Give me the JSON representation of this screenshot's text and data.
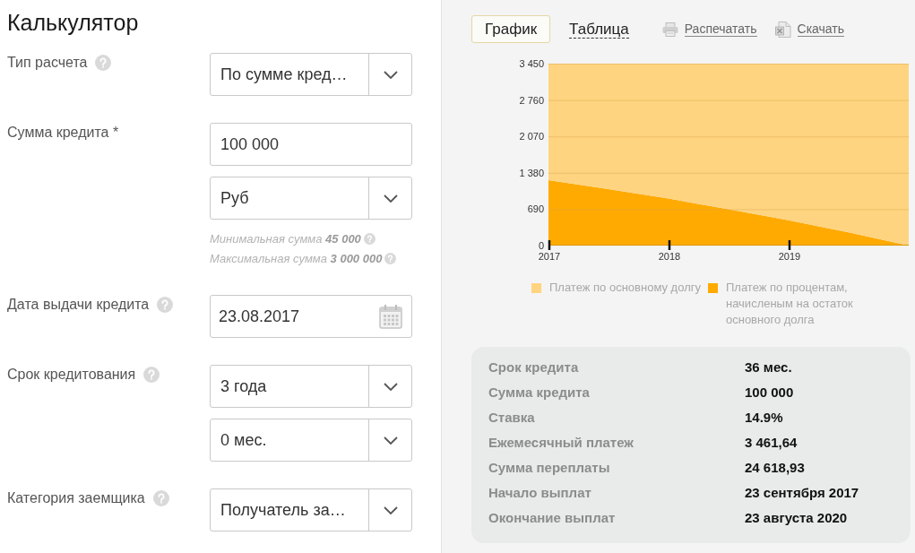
{
  "title": "Калькулятор",
  "fields": [
    {
      "label": "Тип расчета",
      "help": true,
      "controls": [
        {
          "kind": "select",
          "value": "По сумме кред…"
        }
      ]
    },
    {
      "label": "Сумма кредита *",
      "help": false,
      "controls": [
        {
          "kind": "input",
          "value": "100 000"
        },
        {
          "kind": "select",
          "value": "Руб"
        }
      ],
      "hints": [
        "Минимальная сумма **45 000**",
        "Максимальная сумма **3 000 000**"
      ]
    },
    {
      "label": "Дата выдачи кредита",
      "help": true,
      "controls": [
        {
          "kind": "date",
          "value": "23.08.2017"
        }
      ]
    },
    {
      "label": "Срок кредитования",
      "help": true,
      "controls": [
        {
          "kind": "select",
          "value": "3 года"
        },
        {
          "kind": "select",
          "value": "0 мес."
        }
      ]
    },
    {
      "label": "Категория заемщика",
      "help": true,
      "controls": [
        {
          "kind": "select",
          "value": "Получатель за…"
        }
      ]
    }
  ],
  "view_tabs": [
    {
      "label": "График",
      "selected": true
    },
    {
      "label": "Таблица",
      "selected": false
    }
  ],
  "actions": [
    {
      "kind": "print",
      "label": "Распечатать"
    },
    {
      "kind": "download",
      "label": "Скачать"
    }
  ],
  "chart": {
    "chart_data": {
      "type": "area",
      "stacked": true,
      "grid": true,
      "x": [
        2017,
        2017.5,
        2018,
        2018.5,
        2019,
        2019.5,
        2020
      ],
      "xlim": [
        2017,
        2020
      ],
      "ylim": [
        0,
        3450
      ],
      "xticks": [
        2017,
        2018,
        2019
      ],
      "yticks": [
        {
          "value": 0,
          "label": "0"
        },
        {
          "value": 690,
          "label": "690"
        },
        {
          "value": 1380,
          "label": "1 380"
        },
        {
          "value": 2070,
          "label": "2 070"
        },
        {
          "value": 2760,
          "label": "2 760"
        },
        {
          "value": 3450,
          "label": "3 450"
        }
      ],
      "series": [
        {
          "name": "Платеж по основному долгу",
          "color": "#ffd480",
          "values": [
            2210,
            2380,
            2560,
            2760,
            2970,
            3200,
            3450
          ]
        },
        {
          "name": "Платеж по процентам, начисленым на остаток основного долга",
          "color": "#ffaa00",
          "values": [
            1240,
            1070,
            890,
            690,
            480,
            250,
            0
          ]
        }
      ]
    }
  },
  "summary": [
    {
      "label": "Срок кредита",
      "value": "36 мес."
    },
    {
      "label": "Сумма кредита",
      "value": "100 000"
    },
    {
      "label": "Ставка",
      "value": "14.9%"
    },
    {
      "label": "Ежемесячный платеж",
      "value": "3 461,64"
    },
    {
      "label": "Сумма переплаты",
      "value": "24 618,93"
    },
    {
      "label": "Начало выплат",
      "value": "23 сентября 2017"
    },
    {
      "label": "Окончание выплат",
      "value": "23 августа 2020"
    }
  ]
}
